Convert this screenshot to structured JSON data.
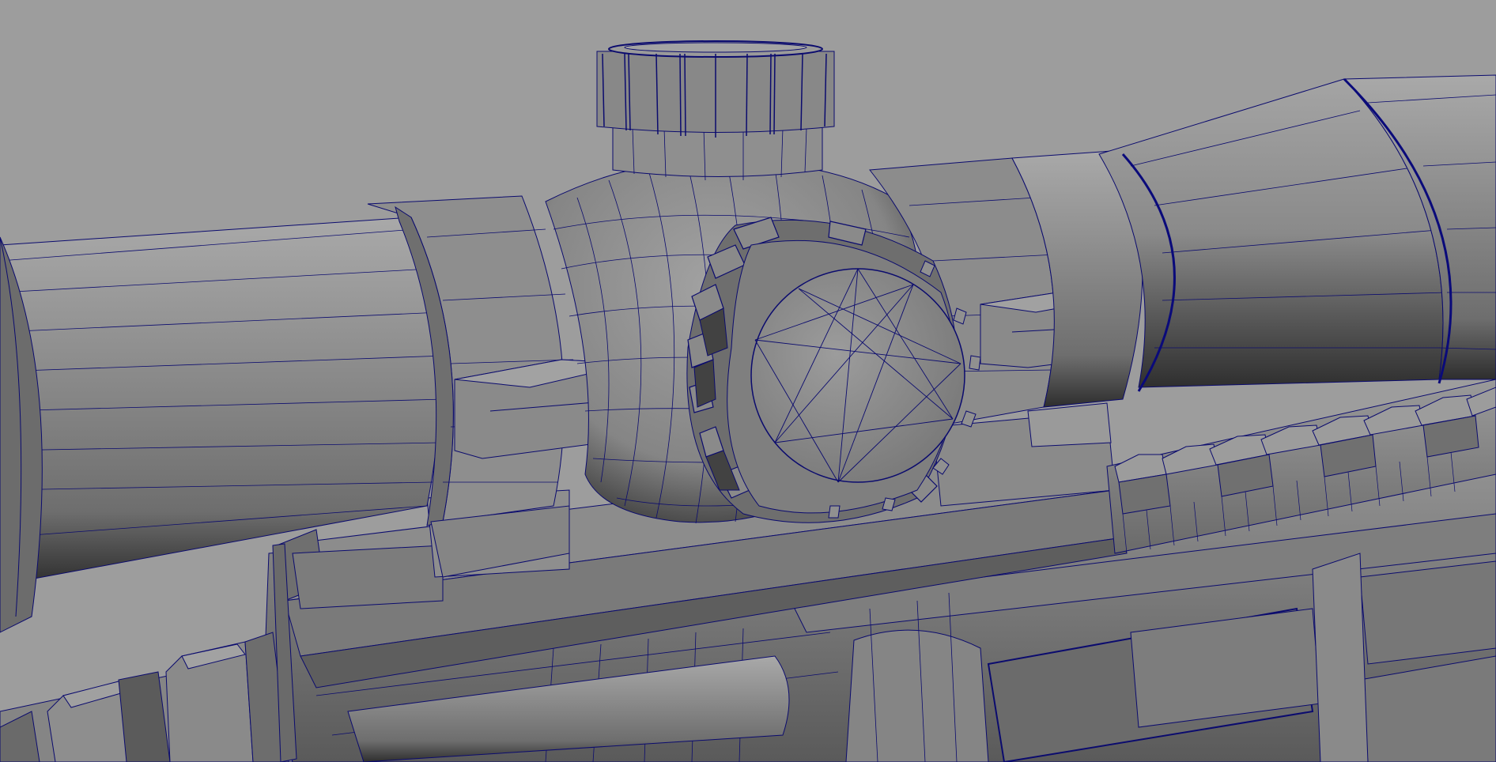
{
  "viewport": {
    "background_color": "#9d9d9d",
    "mesh_base_color": "#8d8d8d",
    "mesh_dark_color": "#3a3a3a",
    "wireframe_color": "#0b0b6e",
    "selected_edge_color": "#0a0a7a",
    "shading_mode": "smooth-shaded-with-wireframe"
  },
  "model": {
    "objects": [
      "rifle-scope",
      "elevation-turret",
      "windage-turret",
      "scope-mount",
      "picatinny-rail",
      "rifle-receiver"
    ]
  }
}
